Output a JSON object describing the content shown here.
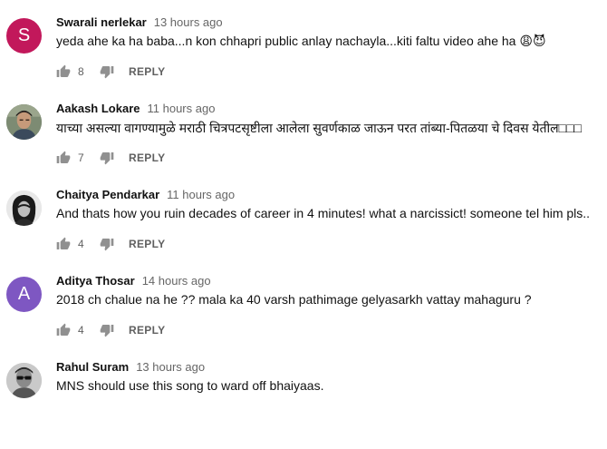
{
  "comments": [
    {
      "author": "Swarali nerlekar",
      "time": "13 hours ago",
      "text": "yeda ahe ka ha baba...n kon chhapri public anlay nachayla...kiti faltu video ahe ha 😩😈",
      "likes": "8",
      "reply_label": "REPLY",
      "avatar": {
        "type": "letter",
        "letter": "S",
        "color": "#c2185b"
      }
    },
    {
      "author": "Aakash Lokare",
      "time": "11 hours ago",
      "text": "याच्या असल्या वागण्यामुळे मराठी चित्रपटसृष्टीला आलेला सुवर्णकाळ जाऊन परत तांब्या-पितळया चे दिवस येतील□□□",
      "likes": "7",
      "reply_label": "REPLY",
      "avatar": {
        "type": "photo",
        "icon": "person-photo-icon"
      }
    },
    {
      "author": "Chaitya Pendarkar",
      "time": "11 hours ago",
      "text": "And thats how you ruin decades of career in 4 minutes! what a narcissict! someone tel him pls..",
      "likes": "4",
      "reply_label": "REPLY",
      "avatar": {
        "type": "photo",
        "icon": "portrait-photo-icon"
      }
    },
    {
      "author": "Aditya Thosar",
      "time": "14 hours ago",
      "text": "2018 ch chalue na he ?? mala ka 40 varsh pathimage gelyasarkh vattay mahaguru ?",
      "likes": "4",
      "reply_label": "REPLY",
      "avatar": {
        "type": "letter",
        "letter": "A",
        "color": "#7e57c2"
      }
    },
    {
      "author": "Rahul Suram",
      "time": "13 hours ago",
      "text": "MNS should use this song to ward off bhaiyaas.",
      "avatar": {
        "type": "photo",
        "icon": "person-sunglasses-icon"
      }
    }
  ]
}
